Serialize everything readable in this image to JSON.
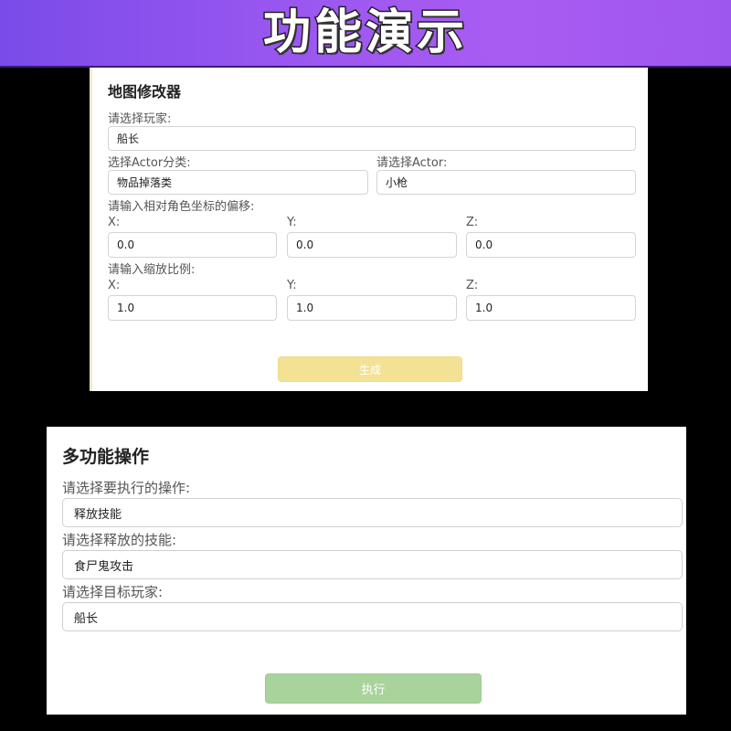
{
  "banner": {
    "title": "功能演示"
  },
  "map_modifier": {
    "heading": "地图修改器",
    "player": {
      "label": "请选择玩家:",
      "value": "船长"
    },
    "actor_category": {
      "label": "选择Actor分类:",
      "value": "物品掉落类"
    },
    "actor": {
      "label": "请选择Actor:",
      "value": "小枪"
    },
    "offset": {
      "label": "请输入相对角色坐标的偏移:",
      "x_label": "X:",
      "y_label": "Y:",
      "z_label": "Z:",
      "x": "0.0",
      "y": "0.0",
      "z": "0.0"
    },
    "scale": {
      "label": "请输入缩放比例:",
      "x_label": "X:",
      "y_label": "Y:",
      "z_label": "Z:",
      "x": "1.0",
      "y": "1.0",
      "z": "1.0"
    },
    "generate_label": "生成",
    "generate_color": "#f3e293"
  },
  "multi_function": {
    "heading": "多功能操作",
    "operation": {
      "label": "请选择要执行的操作:",
      "value": "释放技能"
    },
    "skill": {
      "label": "请选择释放的技能:",
      "value": "食尸鬼攻击"
    },
    "target": {
      "label": "请选择目标玩家:",
      "value": "船长"
    },
    "execute_label": "执行",
    "execute_color": "#a8d39b"
  },
  "colors": {
    "banner_gradient_start": "#7a4be8",
    "banner_gradient_end": "#a95cf2",
    "background": "#000000",
    "panel": "#ffffff"
  }
}
